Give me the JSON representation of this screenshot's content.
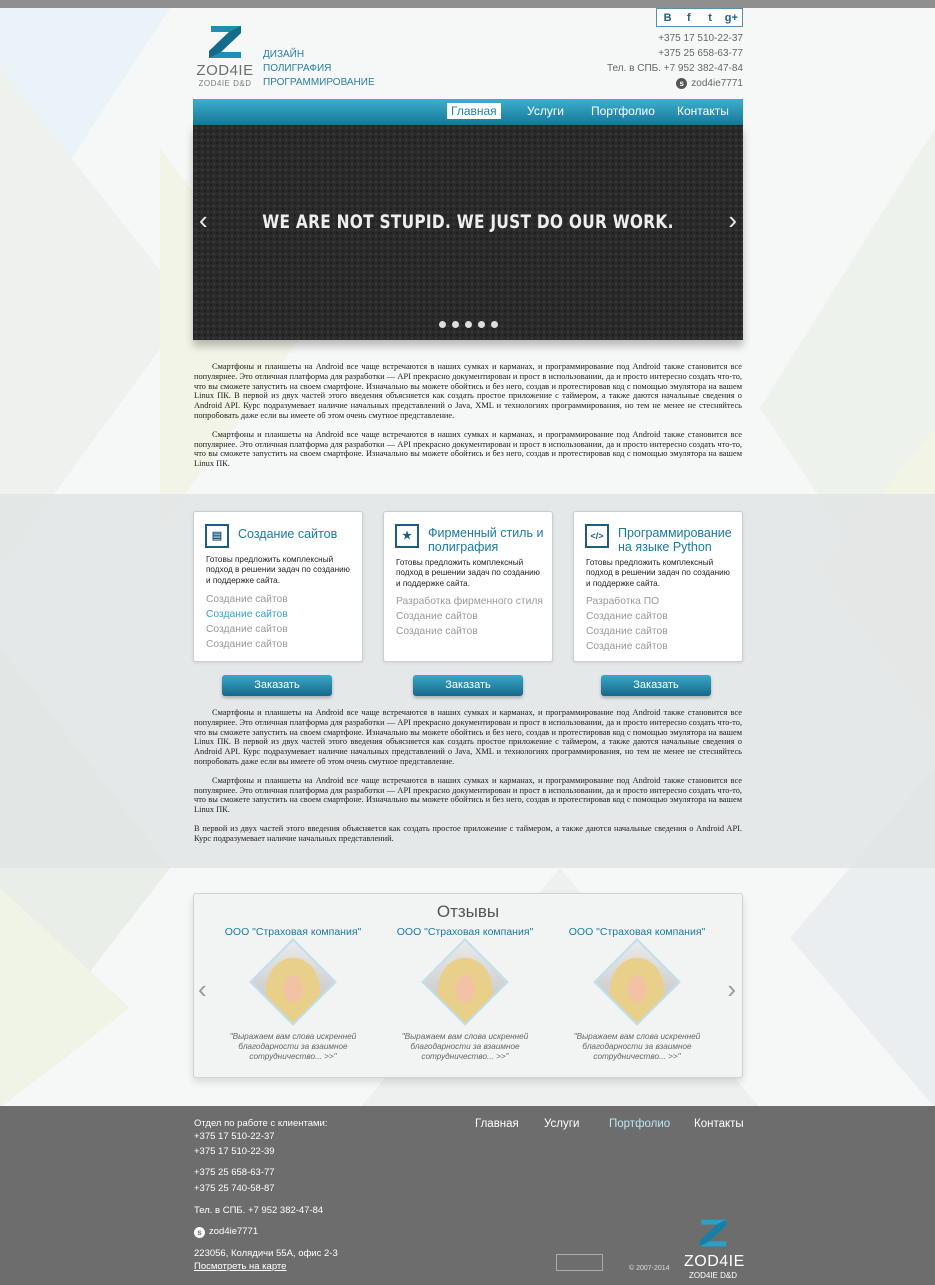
{
  "header": {
    "logo_word": "ZOD4IE",
    "logo_sub": "ZOD4IE D&D",
    "tagline": [
      "ДИЗАЙН",
      "ПОЛИГРАФИЯ",
      "ПРОГРАММИРОВАНИЕ"
    ],
    "social": [
      "B",
      "f",
      "t",
      "g+"
    ],
    "phones": [
      "+375 17 510-22-37",
      "+375 25 658-63-77",
      "Тел. в СПБ. +7 952 382-47-84"
    ],
    "skype": "zod4ie7771"
  },
  "nav": [
    "Главная",
    "Услуги",
    "Портфолио",
    "Контакты"
  ],
  "slider": {
    "headline": "WE ARE NOT STUPID. WE JUST DO OUR WORK.",
    "prev": "‹",
    "next": "›",
    "dot_count": 5
  },
  "text1": [
    "Смартфоны и планшеты на Android все чаще встречаются в наших сумках и карманах, и программирование под Android также становится все популярнее. Это отличная платформа для разработки — API прекрасно документирован и прост в использовании, да и просто интересно создать что-то, что вы сможете запустить на своем смартфоне. Изначально вы можете обойтись и без него, создав и протестировав код с помощью эмулятора на вашем Linux ПК. В первой из двух частей этого введения объясняется как создать простое приложение с таймером, а также даются начальные сведения о Android API. Курс подразумевает наличие начальных представлений о Java, XML и технологиях программирования, но тем не менее не стесняйтесь попробовать даже если вы имеете об этом очень смутное представление.",
    "Смартфоны и планшеты на Android все чаще встречаются в наших сумках и карманах, и программирование под Android также становится все популярнее. Это отличная платформа для разработки — API прекрасно документирован и прост в использовании, да и просто интересно создать что-то, что вы сможете запустить на своем смартфоне. Изначально вы можете обойтись и без него, создав и протестировав код с помощью эмулятора на вашем Linux ПК."
  ],
  "services": [
    {
      "icon": "▤",
      "title": "Создание сайтов",
      "desc": "Готовы предложить комплексный подход в решении задач по созданию и поддержке сайта.",
      "links": [
        "Создание сайтов",
        "Создание сайтов",
        "Создание сайтов",
        "Создание сайтов"
      ],
      "button": "Заказать"
    },
    {
      "icon": "★",
      "title": "Фирменный стиль и полиграфия",
      "desc": "Готовы предложить комплексный подход в решении задач по созданию и поддержке сайта.",
      "links": [
        "Разработка фирменного стиля",
        "Создание сайтов",
        "Создание сайтов"
      ],
      "button": "Заказать"
    },
    {
      "icon": "</>",
      "title": "Программирование на языке Python",
      "desc": "Готовы предложить комплексный подход в решении задач по созданию и поддержке сайта.",
      "links": [
        "Разработка ПО",
        "Создание сайтов",
        "Создание сайтов",
        "Создание сайтов"
      ],
      "button": "Заказать"
    }
  ],
  "text2": [
    "Смартфоны и планшеты на Android все чаще встречаются в наших сумках и карманах, и программирование под Android также становится все популярнее. Это отличная платформа для разработки — API прекрасно документирован и прост в использовании, да и просто интересно создать что-то, что вы сможете запустить на своем смартфоне. Изначально вы можете обойтись и без него, создав и протестировав код с помощью эмулятора на вашем Linux ПК. В первой из двух частей этого введения объясняется как создать простое приложение с таймером, а также даются начальные сведения о Android API. Курс подразумевает наличие начальных представлений о Java, XML и технологиях программирования, но тем не менее не стесняйтесь попробовать даже если вы имеете об этом очень смутное представление.",
    "Смартфоны и планшеты на Android все чаще встречаются в наших сумках и карманах, и программирование под Android также становится все популярнее. Это отличная платформа для разработки — API прекрасно документирован и прост в использовании, да и просто интересно создать что-то, что вы сможете запустить на своем смартфоне. Изначально вы можете обойтись и без него, создав и протестировав код с помощью эмулятора на вашем Linux ПК.",
    "В первой из двух частей этого введения объясняется как создать простое приложение с таймером, а также даются начальные сведения о Android API. Курс подразумевает наличие начальных представлений."
  ],
  "reviews": {
    "title": "Отзывы",
    "prev": "‹",
    "next": "›",
    "items": [
      {
        "company": "ООО \"Страховая компания\"",
        "quote": "\"Выражаем вам слова искренней благодарности за взаимное сотрудничество... >>\""
      },
      {
        "company": "ООО \"Страховая компания\"",
        "quote": "\"Выражаем вам слова искренней благодарности за взаимное сотрудничество... >>\""
      },
      {
        "company": "ООО \"Страховая компания\"",
        "quote": "\"Выражаем вам слова искренней благодарности за взаимное сотрудничество... >>\""
      }
    ]
  },
  "footer": {
    "dept": "Отдел по работе с клиентами:",
    "phones1": [
      "+375 17 510-22-37",
      "+375 17 510-22-39"
    ],
    "phones2": [
      "+375 25 658-63-77",
      "+375 25 740-58-87"
    ],
    "spb": "Тел. в СПБ. +7 952 382-47-84",
    "skype": "zod4ie7771",
    "address": "223056, Колядичи 55А, офис 2-3",
    "map_link": "Посмотреть на карте",
    "nav": [
      "Главная",
      "Услуги",
      "Портфолио",
      "Контакты"
    ],
    "copyright": "© 2007-2014",
    "logo_word": "ZOD4IE",
    "logo_sub": "ZOD4IE D&D"
  },
  "colors": {
    "accent": "#1b7aa0",
    "nav": "#2590b3",
    "footer": "#6d6d6d"
  }
}
